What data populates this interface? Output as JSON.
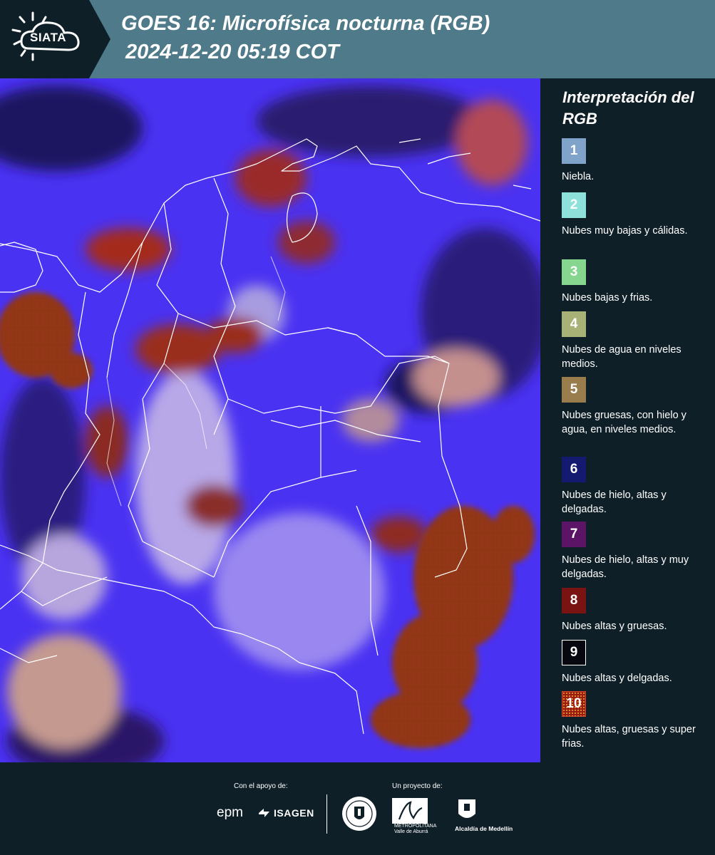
{
  "header": {
    "logo_text": "SIATA",
    "title_line1": "GOES 16: Microfísica nocturna (RGB)",
    "title_line2": "2024-12-20 05:19 COT"
  },
  "legend": {
    "title": "Interpretación del RGB",
    "items": [
      {
        "number": "1",
        "label": "Niebla.",
        "color": "#7fa3c9"
      },
      {
        "number": "2",
        "label": "Nubes muy bajas y cálidas.",
        "color": "#8ee0da"
      },
      {
        "number": "3",
        "label": "Nubes bajas y frias.",
        "color": "#86d68f"
      },
      {
        "number": "4",
        "label": "Nubes de agua en niveles medios.",
        "color": "#a8b276"
      },
      {
        "number": "5",
        "label": "Nubes gruesas, con hielo y agua, en niveles medios.",
        "color": "#9a7d4c"
      },
      {
        "number": "6",
        "label": "Nubes de hielo, altas y delgadas.",
        "color": "#131a6f"
      },
      {
        "number": "7",
        "label": "Nubes de hielo, altas y muy delgadas.",
        "color": "#5b1466"
      },
      {
        "number": "8",
        "label": "Nubes altas y gruesas.",
        "color": "#7a1412"
      },
      {
        "number": "9",
        "label": "Nubes altas y delgadas.",
        "color": "#070710"
      },
      {
        "number": "10",
        "label": "Nubes altas, gruesas y super frias.",
        "color": "#9b1b0e"
      }
    ]
  },
  "footer": {
    "support_label": "Con el apoyo de:",
    "project_label": "Un proyecto de:",
    "epm": "epm",
    "isagen": "ISAGEN",
    "area_subtitle": "METROPOLITANA Valle de Aburrá",
    "medellin": "Alcaldía de Medellín"
  }
}
